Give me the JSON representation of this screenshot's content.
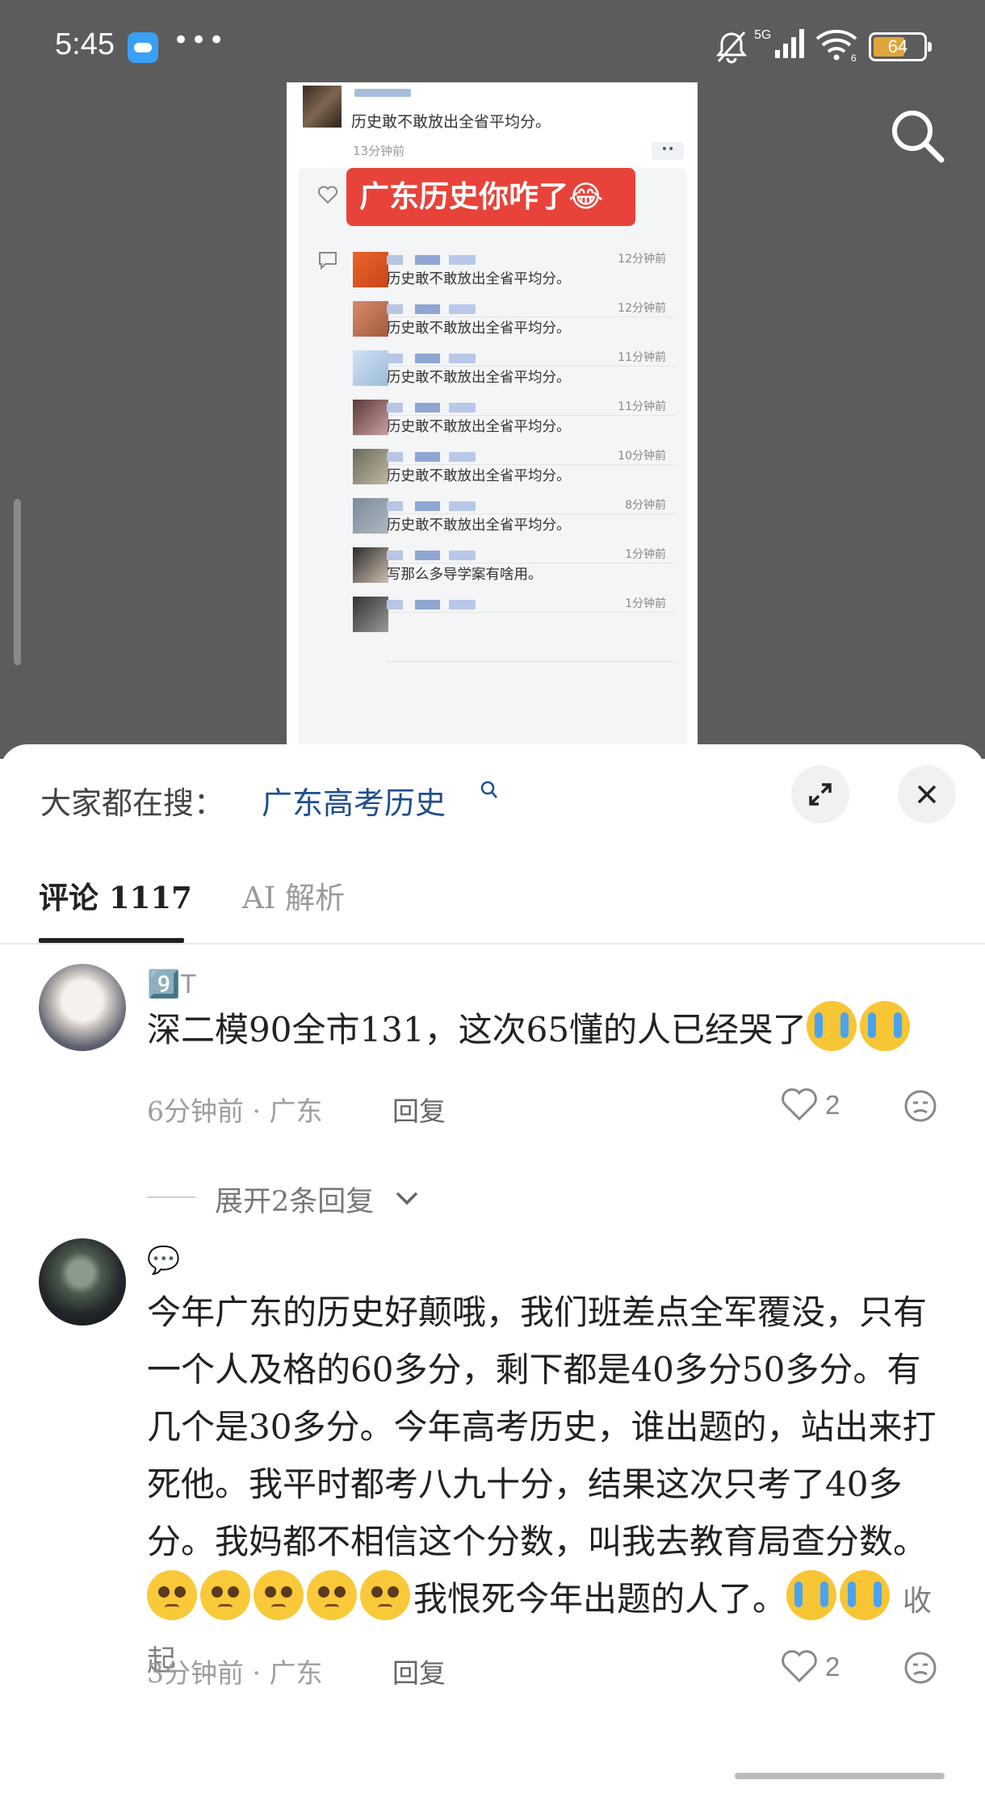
{
  "status_bar": {
    "time": "5:45",
    "dots": "•••",
    "network": "5G",
    "battery_level": "64",
    "battery_fraction": 0.64,
    "icons": [
      "cloud-app-icon",
      "mute-bell-icon",
      "signal-5g-icon",
      "wifi-icon",
      "battery-icon"
    ]
  },
  "embedded_image": {
    "top_comment_text": "历史敢不敢放出全省平均分。",
    "top_comment_time": "13分钟前",
    "top_dots": "••",
    "banner_text": "广东历史你咋了😂",
    "replies": [
      {
        "text": "历史敢不敢放出全省平均分。",
        "time": "12分钟前"
      },
      {
        "text": "历史敢不敢放出全省平均分。",
        "time": "12分钟前"
      },
      {
        "text": "历史敢不敢放出全省平均分。",
        "time": "11分钟前"
      },
      {
        "text": "历史敢不敢放出全省平均分。",
        "time": "11分钟前"
      },
      {
        "text": "历史敢不敢放出全省平均分。",
        "time": "10分钟前"
      },
      {
        "text": "历史敢不敢放出全省平均分。",
        "time": "8分钟前"
      },
      {
        "text": "写那么多导学案有啥用。",
        "time": "1分钟前"
      },
      {
        "text": "",
        "time": "1分钟前"
      }
    ]
  },
  "sheet": {
    "search_hint_label": "大家都在搜：",
    "search_hint_term": "广东高考历史",
    "tabs": [
      {
        "label": "评论 1117",
        "active": true
      },
      {
        "label": "AI 解析",
        "active": false
      }
    ]
  },
  "comments": [
    {
      "username": "9️⃣T",
      "body": "深二模90全市131，这次65懂的人已经哭了",
      "time_location": "6分钟前 · 广东",
      "reply": "回复",
      "likes": "2",
      "expand_replies": "展开2条回复"
    },
    {
      "username": "💬",
      "body": "今年广东的历史好颠哦，我们班差点全军覆没，只有一个人及格的60多分，剩下都是40多分50多分。有几个是30多分。今年高考历史，谁出题的，站出来打死他。我平时都考八九十分，结果这次只考了40多分。我妈都不相信这个分数，叫我去教育局查分数。",
      "body_tail": "我恨死今年出题的人了。",
      "collapse": "收起",
      "time_location": "3分钟前 · 广东",
      "reply": "回复",
      "likes": "2"
    }
  ],
  "colors": {
    "top_background": "#5c5c5c",
    "banner": "#e8433a",
    "search_term": "#1f4e8c",
    "battery": "#e0a53a"
  }
}
